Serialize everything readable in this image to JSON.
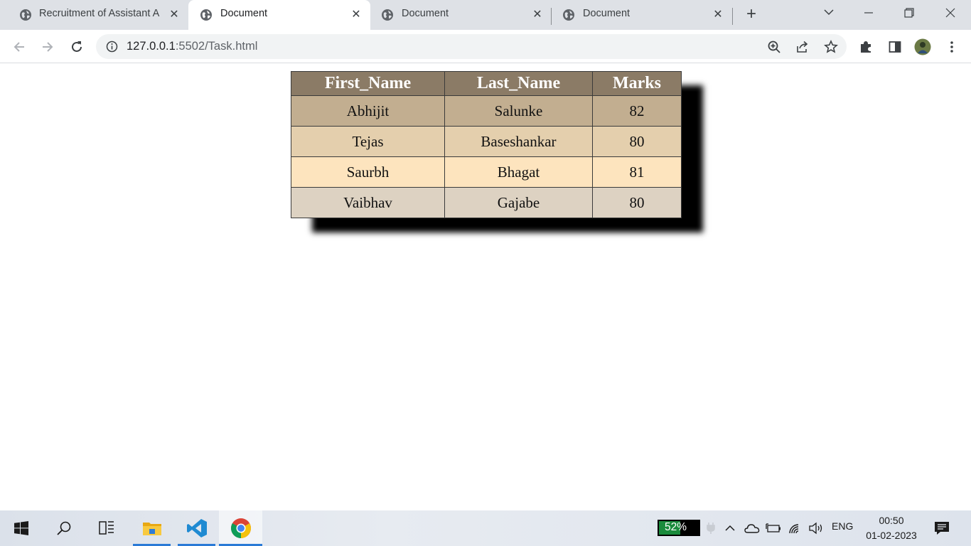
{
  "browser": {
    "tabs": [
      {
        "title": "Recruitment of Assistant A",
        "active": false
      },
      {
        "title": "Document",
        "active": true
      },
      {
        "title": "Document",
        "active": false
      },
      {
        "title": "Document",
        "active": false
      }
    ],
    "new_tab_symbol": "+",
    "url_host": "127.0.0.1",
    "url_path": ":5502/Task.html"
  },
  "table": {
    "headers": [
      "First_Name",
      "Last_Name",
      "Marks"
    ],
    "rows": [
      [
        "Abhijit",
        "Salunke",
        "82"
      ],
      [
        "Tejas",
        "Baseshankar",
        "80"
      ],
      [
        "Saurbh",
        "Bhagat",
        "81"
      ],
      [
        "Vaibhav",
        "Gajabe",
        "80"
      ]
    ],
    "colors": {
      "header": "#8b7b66",
      "row_backgrounds": [
        "#c2ae90",
        "#e4cfad",
        "#fde4be",
        "#ddd2c2"
      ],
      "shadow": "#000000"
    }
  },
  "taskbar": {
    "battery_percent": "52%",
    "language": "ENG",
    "time": "00:50",
    "date": "01-02-2023"
  }
}
